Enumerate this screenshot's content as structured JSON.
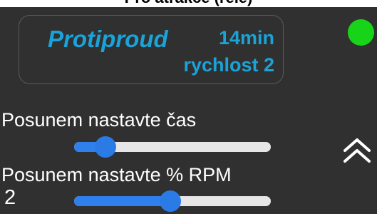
{
  "header": {
    "title": "Pro atrakce (relé)"
  },
  "program": {
    "name": "Protiproud",
    "duration": "14min",
    "speed": "rychlost 2"
  },
  "status": {
    "indicator_color": "#18d418",
    "state": "active"
  },
  "time_control": {
    "label": "Posunem nastavte čas",
    "level": 0.16
  },
  "rpm_control": {
    "label": "Posunem nastavte % RPM",
    "value": "2",
    "level": 0.49
  },
  "colors": {
    "accent": "#1aa3d9",
    "slider": "#2f80ed",
    "panel": "#303030"
  },
  "icons": {
    "expand": "double-chevron-up-icon"
  }
}
